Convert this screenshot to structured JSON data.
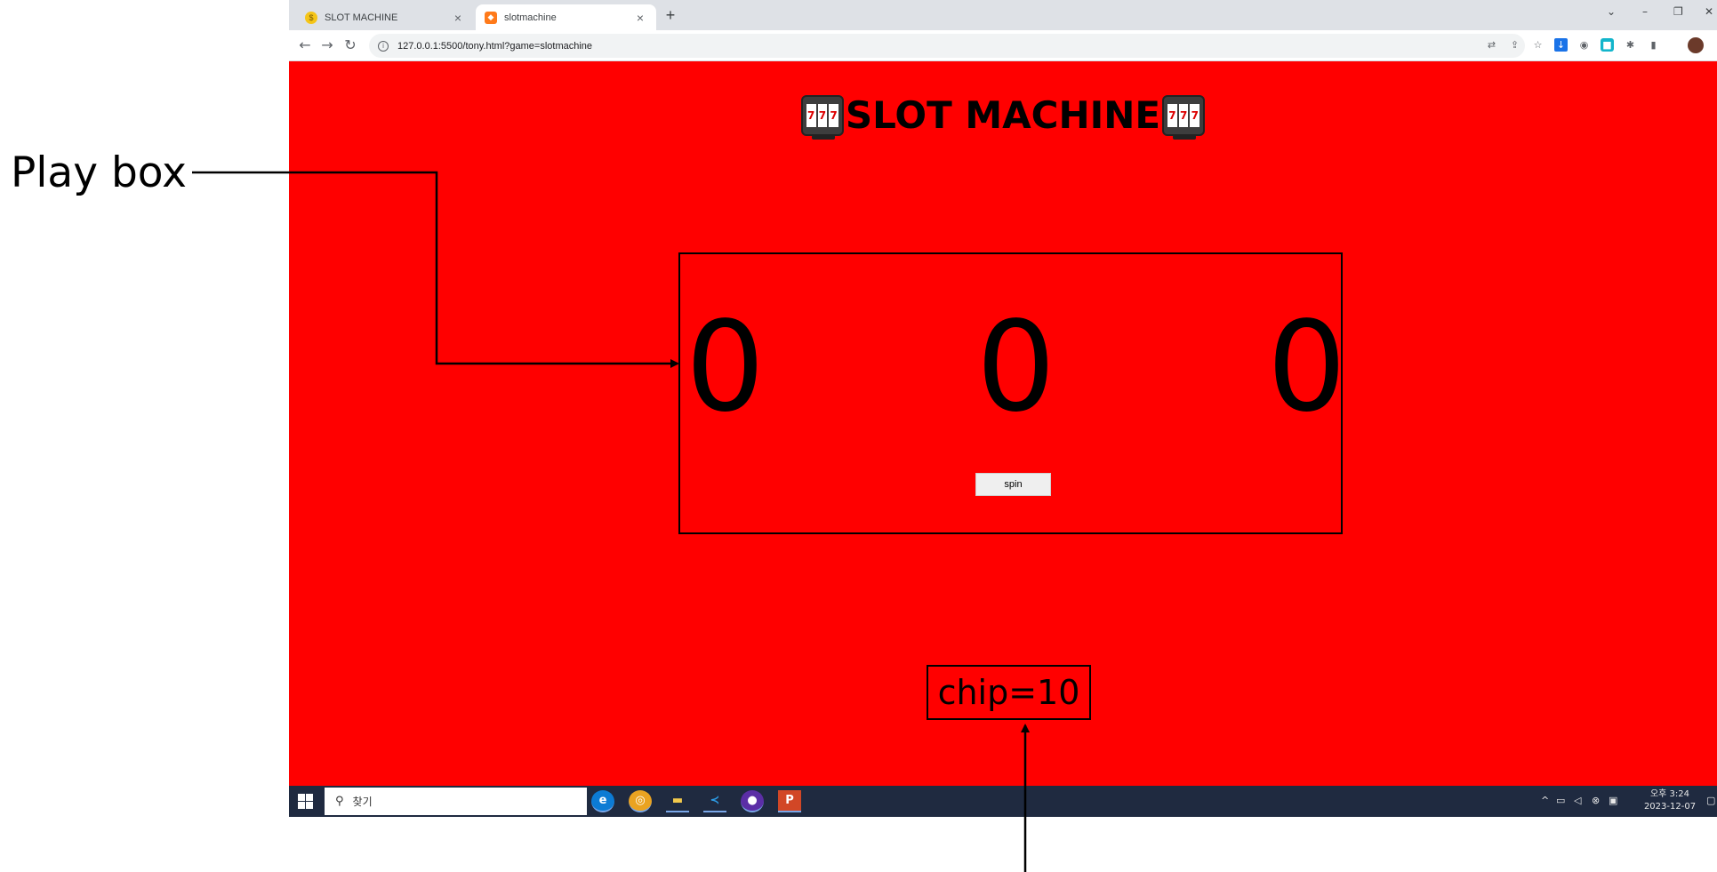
{
  "annotations": {
    "play_box_label": "Play box"
  },
  "browser": {
    "tabs": [
      {
        "title": "SLOT MACHINE",
        "favicon": "coin-icon",
        "active": false
      },
      {
        "title": "slotmachine",
        "favicon": "shield-icon",
        "active": true
      }
    ],
    "new_tab": "+",
    "url": "127.0.0.1:5500/tony.html?game=slotmachine"
  },
  "page": {
    "title": "SLOT MACHINE",
    "icon": "slot-machine-icon",
    "reel_symbol": "7",
    "reels": [
      "0",
      "0",
      "0"
    ],
    "spin_label": "spin",
    "chip_text": "chip=10",
    "background_color": "#ff0000"
  },
  "taskbar": {
    "search_placeholder": "찾기",
    "clock_time": "오후 3:24",
    "clock_date": "2023-12-07"
  }
}
